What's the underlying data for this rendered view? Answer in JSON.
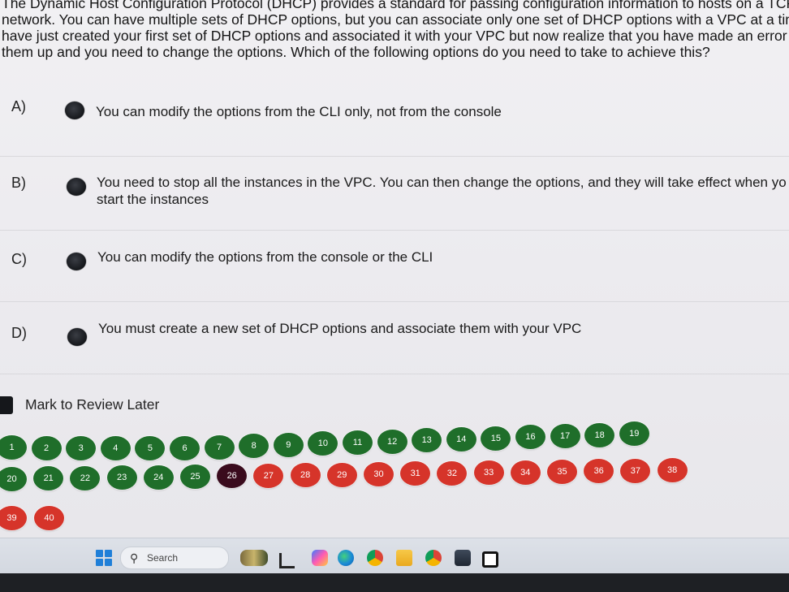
{
  "question": {
    "lines": [
      "The Dynamic Host Configuration Protocol (DHCP) provides a standard for passing configuration information to hosts on a TCP/IP",
      "network. You can have multiple sets of DHCP options, but you can associate only one set of DHCP options with a VPC at a time.",
      "have just created your first set of DHCP options and associated it with your VPC but now realize that you have made an error in",
      "them up and you need to change the options. Which of the following options do you need to take to achieve this?"
    ]
  },
  "options": [
    {
      "letter": "A)",
      "lines": [
        "You can modify the options from the CLI only, not from the console"
      ]
    },
    {
      "letter": "B)",
      "lines": [
        "You need to stop all the instances in the VPC. You can then change the options, and they will take effect when yo",
        "start the instances"
      ]
    },
    {
      "letter": "C)",
      "lines": [
        "You can modify the options from the console or the CLI"
      ]
    },
    {
      "letter": "D)",
      "lines": [
        "You must create a new set of DHCP options and associate them with your VPC"
      ]
    }
  ],
  "review": {
    "label": "Mark to Review Later",
    "checked": true
  },
  "navigation": {
    "row1": [
      "1",
      "2",
      "3",
      "4",
      "5",
      "6",
      "7",
      "8",
      "9",
      "10",
      "11",
      "12",
      "13",
      "14",
      "15",
      "16",
      "17",
      "18",
      "19"
    ],
    "row2": [
      "20",
      "21",
      "22",
      "23",
      "24",
      "25",
      "26",
      "27",
      "28",
      "29",
      "30",
      "31",
      "32",
      "33",
      "34",
      "35",
      "36",
      "37",
      "38"
    ],
    "row3": [
      "39",
      "40"
    ],
    "current": "26",
    "answered_through": 25,
    "colors": {
      "answered": "#1f6e2a",
      "current": "#3a0b1d",
      "unanswered": "#d6342a"
    }
  },
  "taskbar": {
    "search_label": "Search",
    "icons": [
      "windows-start-icon",
      "search-icon",
      "widgets-icon",
      "task-view-icon",
      "copilot-icon",
      "edge-icon",
      "chrome-icon",
      "file-explorer-icon",
      "chrome-icon",
      "store-icon",
      "terminal-icon"
    ]
  }
}
